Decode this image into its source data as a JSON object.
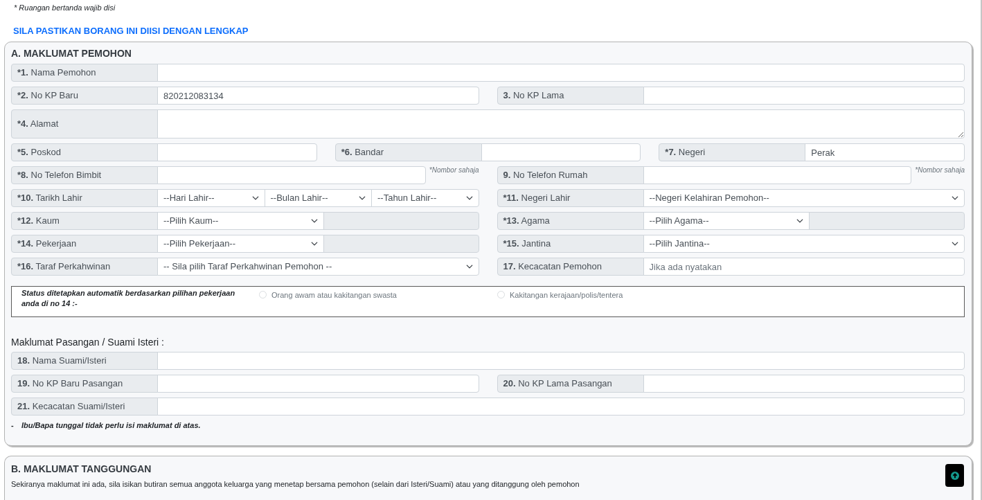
{
  "notice": "* Ruangan bertanda wajib disi",
  "heading": "SILA PASTIKAN BORANG INI DIISI DENGAN LENGKAP",
  "section_a": {
    "title": "A. MAKLUMAT PEMOHON",
    "rows": [
      {
        "fields": [
          {
            "number": "*1.",
            "label": "Nama Pemohon",
            "controls": [
              {
                "kind": "text"
              }
            ]
          }
        ]
      },
      {
        "fields": [
          {
            "number": "*2.",
            "label": "No KP Baru",
            "controls": [
              {
                "kind": "text",
                "value": "820212083134"
              }
            ]
          },
          {
            "number": "3.",
            "label": "No KP Lama",
            "controls": [
              {
                "kind": "text"
              }
            ]
          }
        ]
      },
      {
        "fields": [
          {
            "number": "*4.",
            "label": "Alamat",
            "controls": [
              {
                "kind": "textarea"
              }
            ]
          }
        ]
      },
      {
        "fields": [
          {
            "number": "*5.",
            "label": "Poskod",
            "controls": [
              {
                "kind": "text"
              }
            ]
          },
          {
            "number": "*6.",
            "label": "Bandar",
            "controls": [
              {
                "kind": "text"
              }
            ]
          },
          {
            "number": "*7.",
            "label": "Negeri",
            "controls": [
              {
                "kind": "text",
                "value": "Perak"
              }
            ]
          }
        ]
      },
      {
        "fields": [
          {
            "number": "*8.",
            "label": "No Telefon Bimbit",
            "controls": [
              {
                "kind": "text"
              }
            ],
            "hint": "*Nombor sahaja"
          },
          {
            "number": "9.",
            "label": "No Telefon Rumah",
            "controls": [
              {
                "kind": "text"
              }
            ],
            "hint": "*Nombor sahaja"
          }
        ]
      },
      {
        "fields": [
          {
            "number": "*10.",
            "label": "Tarikh Lahir",
            "controls": [
              {
                "kind": "select",
                "value": "--Hari Lahir--"
              },
              {
                "kind": "select",
                "value": "--Bulan Lahir--"
              },
              {
                "kind": "select",
                "value": "--Tahun Lahir--"
              }
            ]
          },
          {
            "number": "*11.",
            "label": "Negeri Lahir",
            "controls": [
              {
                "kind": "select",
                "value": "--Negeri Kelahiran Pemohon--"
              }
            ]
          }
        ]
      },
      {
        "fields": [
          {
            "number": "*12.",
            "label": "Kaum",
            "controls": [
              {
                "kind": "select",
                "value": "--Pilih Kaum--"
              },
              {
                "kind": "readonly"
              }
            ]
          },
          {
            "number": "*13.",
            "label": "Agama",
            "controls": [
              {
                "kind": "select",
                "value": "--Pilih Agama--"
              },
              {
                "kind": "readonly"
              }
            ]
          }
        ]
      },
      {
        "fields": [
          {
            "number": "*14.",
            "label": "Pekerjaan",
            "controls": [
              {
                "kind": "select",
                "value": "--Pilih Pekerjaan--"
              },
              {
                "kind": "readonly"
              }
            ]
          },
          {
            "number": "*15.",
            "label": "Jantina",
            "controls": [
              {
                "kind": "select",
                "value": "--Pilih Jantina--"
              }
            ]
          }
        ]
      },
      {
        "fields": [
          {
            "number": "*16.",
            "label": "Taraf Perkahwinan",
            "controls": [
              {
                "kind": "select",
                "value": "-- Sila pilih Taraf Perkahwinan Pemohon --"
              }
            ]
          },
          {
            "number": "17.",
            "label": "Kecacatan Pemohon",
            "controls": [
              {
                "kind": "text",
                "placeholder": "Jika ada nyatakan"
              }
            ]
          }
        ]
      }
    ],
    "status_box": {
      "text": "Status ditetapkan automatik berdasarkan pilihan pekerjaan anda di no 14 :-",
      "options": [
        {
          "label": "Orang awam atau kakitangan swasta",
          "selected": false,
          "disabled": true
        },
        {
          "label": "Kakitangan kerajaan/polis/tentera",
          "selected": false,
          "disabled": true
        }
      ]
    },
    "spouse": {
      "heading": "Maklumat Pasangan / Suami Isteri :",
      "rows": [
        {
          "fields": [
            {
              "number": "18.",
              "label": "Nama Suami/Isteri",
              "controls": [
                {
                  "kind": "text"
                }
              ]
            }
          ]
        },
        {
          "fields": [
            {
              "number": "19.",
              "label": "No KP Baru Pasangan",
              "controls": [
                {
                  "kind": "text"
                }
              ]
            },
            {
              "number": "20.",
              "label": "No KP Lama Pasangan",
              "controls": [
                {
                  "kind": "text"
                }
              ]
            }
          ]
        },
        {
          "fields": [
            {
              "number": "21.",
              "label": "Kecacatan Suami/Isteri",
              "controls": [
                {
                  "kind": "text"
                }
              ]
            }
          ]
        }
      ]
    },
    "note": {
      "marker": "-",
      "text": "Ibu/Bapa tunggal tidak perlu isi maklumat di atas."
    }
  },
  "section_b": {
    "title": "B. MAKLUMAT TANGGUNGAN",
    "description": "Sekiranya maklumat ini ada, sila isikan butiran semua anggota keluarga yang menetap bersama pemohon (selain dari Isteri/Suami) atau yang ditanggung oleh pemohon"
  }
}
